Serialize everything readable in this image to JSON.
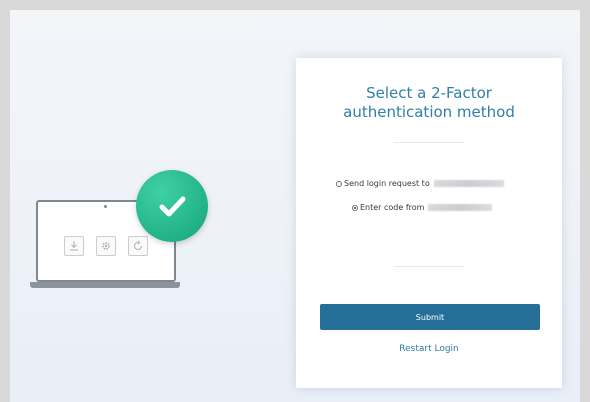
{
  "title": {
    "line1": "Select a 2-Factor",
    "line2": "authentication method"
  },
  "options": [
    {
      "label": "Send login request to",
      "selected": false
    },
    {
      "label": "Enter code from",
      "selected": true
    }
  ],
  "submit_label": "Submit",
  "restart_label": "Restart Login",
  "icons": {
    "status": "check-icon",
    "laptop": [
      "download-icon",
      "gear-icon",
      "refresh-icon"
    ]
  },
  "colors": {
    "accent": "#2f7fa8",
    "button": "#246e98",
    "success": "#25b68c"
  }
}
